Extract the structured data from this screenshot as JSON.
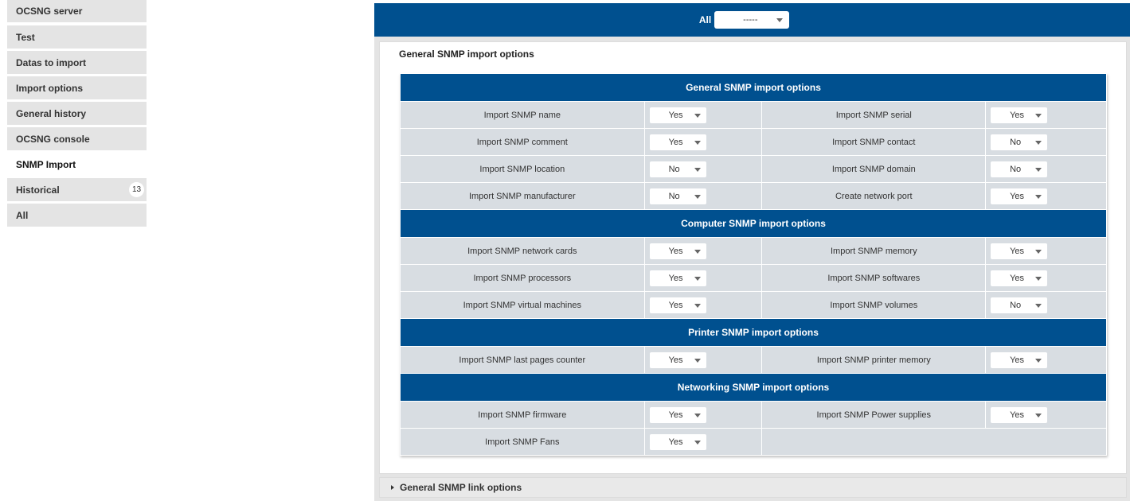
{
  "sidebar": {
    "items": [
      {
        "label": "OCSNG server"
      },
      {
        "label": "Test"
      },
      {
        "label": "Datas to import"
      },
      {
        "label": "Import options"
      },
      {
        "label": "General history"
      },
      {
        "label": "OCSNG console"
      },
      {
        "label": "SNMP Import",
        "active": true
      },
      {
        "label": "Historical",
        "badge": "13"
      },
      {
        "label": "All"
      }
    ]
  },
  "top_bar": {
    "all_label": "All",
    "select_value": "-----"
  },
  "panel": {
    "title": "General SNMP import options",
    "sections": [
      {
        "title": "General SNMP import options",
        "rows": [
          {
            "left_label": "Import SNMP name",
            "left_value": "Yes",
            "right_label": "Import SNMP serial",
            "right_value": "Yes"
          },
          {
            "left_label": "Import SNMP comment",
            "left_value": "Yes",
            "right_label": "Import SNMP contact",
            "right_value": "No"
          },
          {
            "left_label": "Import SNMP location",
            "left_value": "No",
            "right_label": "Import SNMP domain",
            "right_value": "No"
          },
          {
            "left_label": "Import SNMP manufacturer",
            "left_value": "No",
            "right_label": "Create network port",
            "right_value": "Yes"
          }
        ]
      },
      {
        "title": "Computer SNMP import options",
        "rows": [
          {
            "left_label": "Import SNMP network cards",
            "left_value": "Yes",
            "right_label": "Import SNMP memory",
            "right_value": "Yes"
          },
          {
            "left_label": "Import SNMP processors",
            "left_value": "Yes",
            "right_label": "Import SNMP softwares",
            "right_value": "Yes"
          },
          {
            "left_label": "Import SNMP virtual machines",
            "left_value": "Yes",
            "right_label": "Import SNMP volumes",
            "right_value": "No"
          }
        ]
      },
      {
        "title": "Printer SNMP import options",
        "rows": [
          {
            "left_label": "Import SNMP last pages counter",
            "left_value": "Yes",
            "right_label": "Import SNMP printer memory",
            "right_value": "Yes"
          }
        ]
      },
      {
        "title": "Networking SNMP import options",
        "rows": [
          {
            "left_label": "Import SNMP firmware",
            "left_value": "Yes",
            "right_label": "Import SNMP Power supplies",
            "right_value": "Yes"
          },
          {
            "left_label": "Import SNMP Fans",
            "left_value": "Yes",
            "right_label": "",
            "right_value": ""
          }
        ]
      }
    ]
  },
  "link_options": {
    "label": "General SNMP link options",
    "icon": "triangle-right-icon"
  },
  "colors": {
    "header_blue": "#00508f",
    "row_bg": "#d8dde2",
    "sidebar_bg": "#e4e4e4"
  }
}
